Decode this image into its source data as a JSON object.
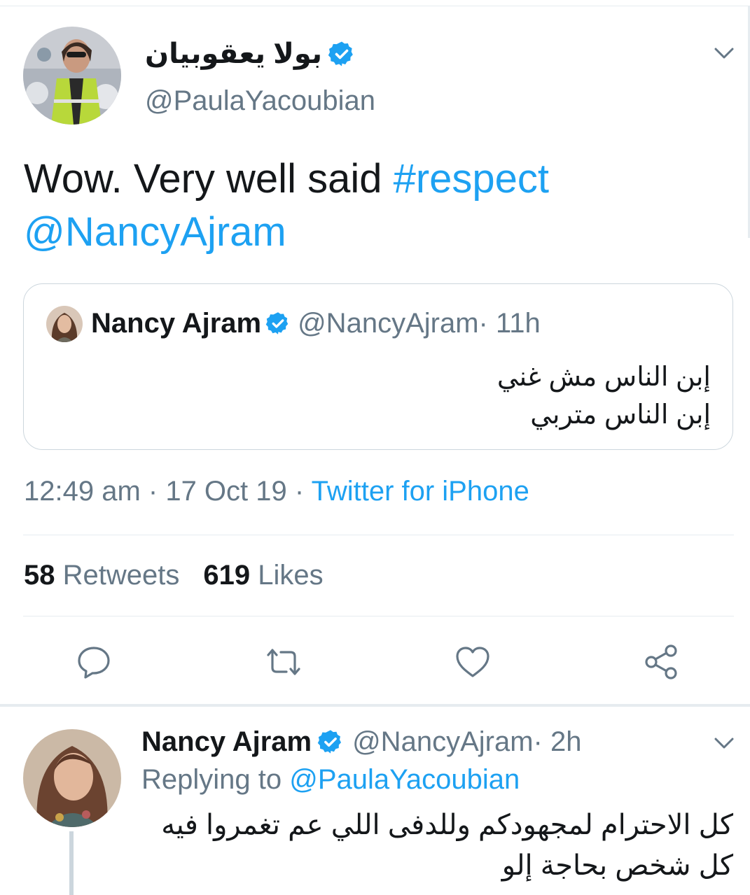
{
  "tweet": {
    "author_name": "بولا يعقوبيان",
    "author_handle": "@PaulaYacoubian",
    "text_plain": "Wow. Very well said ",
    "hashtag": "#respect",
    "mention": "@NancyAjram",
    "timestamp": "12:49 am · 17 Oct 19 · ",
    "source": "Twitter for iPhone",
    "retweets_count": "58",
    "retweets_label": "Retweets",
    "likes_count": "619",
    "likes_label": "Likes"
  },
  "quoted": {
    "author_name": "Nancy Ajram",
    "author_handle": "@NancyAjram",
    "time": " · 11h",
    "line1": "إبن الناس مش غني",
    "line2": "إبن الناس متربي"
  },
  "reply": {
    "author_name": "Nancy Ajram",
    "author_handle": "@NancyAjram",
    "time": " · 2h",
    "replying_label": "Replying to ",
    "replying_handle": "@PaulaYacoubian",
    "text": "كل الاحترام لمجهودكم وللدفى اللي عم تغمروا فيه كل شخص بحاجة إلو"
  },
  "icons": [
    "chevron-down-icon",
    "verified-badge-icon",
    "reply-icon",
    "retweet-icon",
    "like-icon",
    "share-icon"
  ],
  "colors": {
    "accent": "#1da1f2",
    "muted": "#657786",
    "text": "#14171a",
    "border": "#e6ecf0"
  }
}
